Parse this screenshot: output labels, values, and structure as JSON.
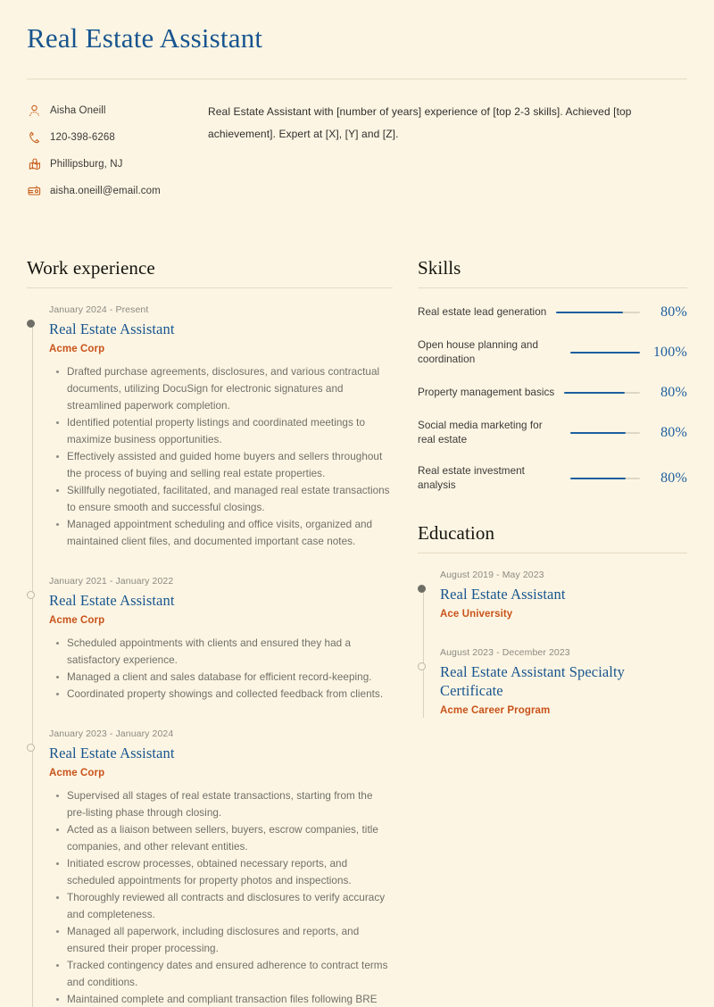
{
  "theme": {
    "background": "#FDF5E3",
    "accent_blue": "#17558F",
    "accent_orange": "#C8531A",
    "body_text": "#6F6F68",
    "muted_text": "#8A8A82"
  },
  "header": {
    "title": "Real Estate Assistant"
  },
  "contact": {
    "items": [
      {
        "icon": "person-icon",
        "text": "Aisha Oneill"
      },
      {
        "icon": "phone-icon",
        "text": "120-398-6268"
      },
      {
        "icon": "location-icon",
        "text": "Phillipsburg, NJ"
      },
      {
        "icon": "mailbox-icon",
        "text": "aisha.oneill@email.com"
      }
    ]
  },
  "summary": {
    "text": "Real Estate Assistant with [number of years] experience of [top 2-3 skills]. Achieved [top achievement]. Expert at [X], [Y] and [Z]."
  },
  "work_experience": {
    "heading": "Work experience",
    "entries": [
      {
        "date": "January 2024 - Present",
        "title": "Real Estate Assistant",
        "org": "Acme Corp",
        "marker": "filled",
        "bullets": [
          "Drafted purchase agreements, disclosures, and various contractual documents, utilizing DocuSign for electronic signatures and streamlined paperwork completion.",
          "Identified potential property listings and coordinated meetings to maximize business opportunities.",
          "Effectively assisted and guided home buyers and sellers throughout the process of buying and selling real estate properties.",
          "Skillfully negotiated, facilitated, and managed real estate transactions to ensure smooth and successful closings.",
          "Managed appointment scheduling and office visits, organized and maintained client files, and documented important case notes."
        ]
      },
      {
        "date": "January 2021 - January 2022",
        "title": "Real Estate Assistant",
        "org": "Acme Corp",
        "marker": "hollow",
        "bullets": [
          "Scheduled appointments with clients and ensured they had a satisfactory experience.",
          "Managed a client and sales database for efficient record-keeping.",
          "Coordinated property showings and collected feedback from clients."
        ]
      },
      {
        "date": "January 2023 - January 2024",
        "title": "Real Estate Assistant",
        "org": "Acme Corp",
        "marker": "hollow",
        "bullets": [
          "Supervised all stages of real estate transactions, starting from the pre-listing phase through closing.",
          "Acted as a liaison between sellers, buyers, escrow companies, title companies, and other relevant entities.",
          "Initiated escrow processes, obtained necessary reports, and scheduled appointments for property photos and inspections.",
          "Thoroughly reviewed all contracts and disclosures to verify accuracy and completeness.",
          "Managed all paperwork, including disclosures and reports, and ensured their proper processing.",
          "Tracked contingency dates and ensured adherence to contract terms and conditions.",
          "Maintained complete and compliant transaction files following BRE"
        ]
      }
    ]
  },
  "skills": {
    "heading": "Skills",
    "items": [
      {
        "name": "Real estate lead generation",
        "percent_label": "80%",
        "percent": 80
      },
      {
        "name": "Open house planning and coordination",
        "percent_label": "100%",
        "percent": 100
      },
      {
        "name": "Property management basics",
        "percent_label": "80%",
        "percent": 80
      },
      {
        "name": "Social media marketing for real estate",
        "percent_label": "80%",
        "percent": 80
      },
      {
        "name": "Real estate investment analysis",
        "percent_label": "80%",
        "percent": 80
      }
    ]
  },
  "education": {
    "heading": "Education",
    "entries": [
      {
        "date": "August 2019 - May 2023",
        "title": "Real Estate Assistant",
        "org": "Ace University",
        "marker": "filled"
      },
      {
        "date": "August 2023 - December 2023",
        "title": "Real Estate Assistant Specialty Certificate",
        "org": "Acme Career Program",
        "marker": "hollow"
      }
    ]
  }
}
